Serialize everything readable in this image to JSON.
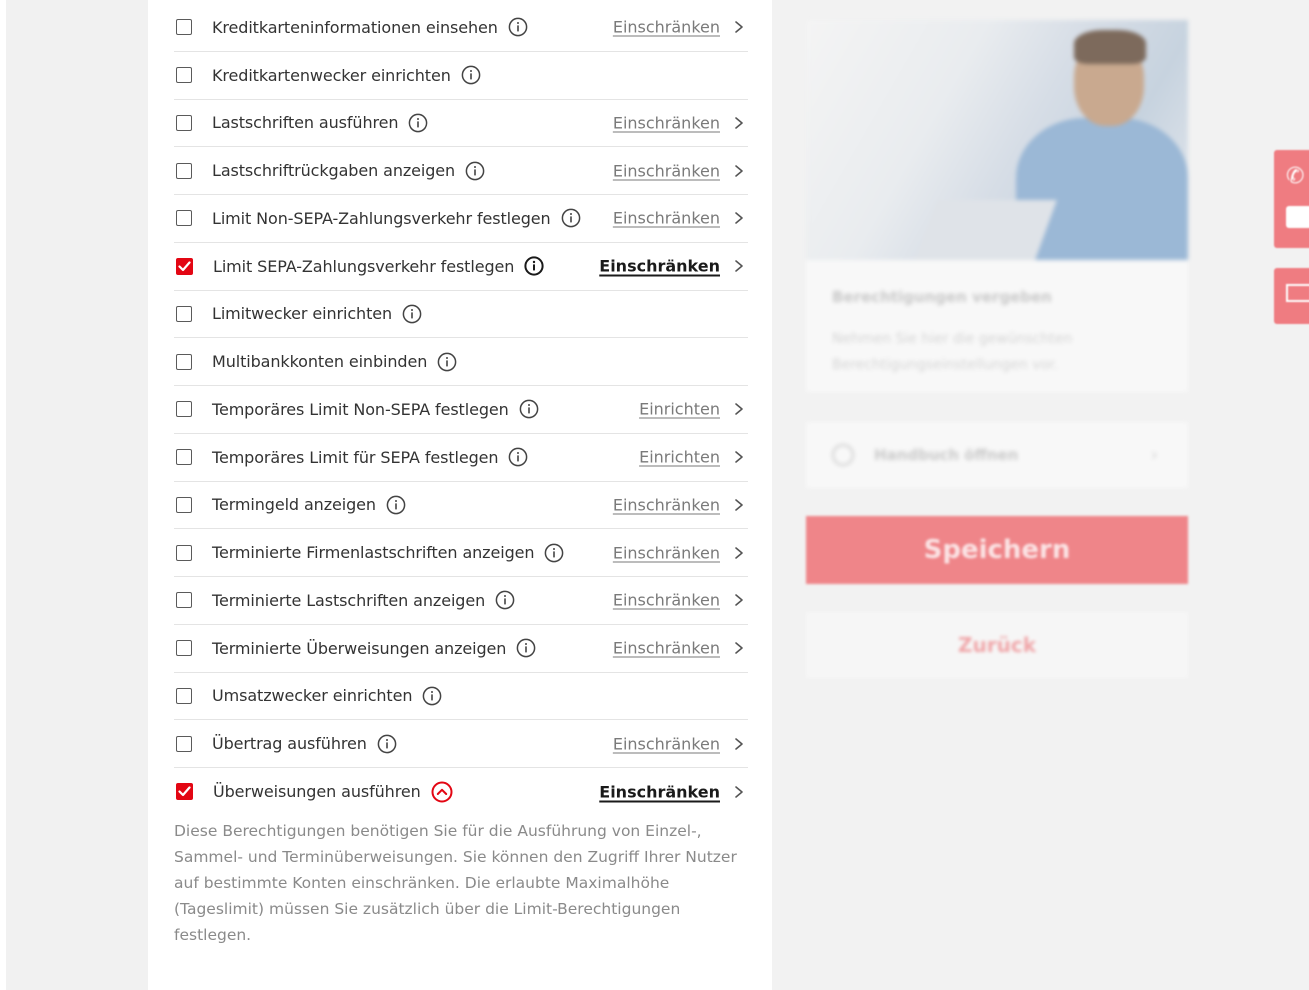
{
  "permissions": [
    {
      "label": "Kreditkarteninformationen einsehen",
      "checked": false,
      "action": "Einschränken",
      "action_active": false,
      "info_icon": "info-icon"
    },
    {
      "label": "Kreditkartenwecker einrichten",
      "checked": false,
      "action": "",
      "action_active": false,
      "info_icon": "info-icon"
    },
    {
      "label": "Lastschriften ausführen",
      "checked": false,
      "action": "Einschränken",
      "action_active": false,
      "info_icon": "info-icon"
    },
    {
      "label": "Lastschriftrückgaben anzeigen",
      "checked": false,
      "action": "Einschränken",
      "action_active": false,
      "info_icon": "info-icon"
    },
    {
      "label": "Limit Non-SEPA-Zahlungsverkehr festlegen",
      "checked": false,
      "action": "Einschränken",
      "action_active": false,
      "info_icon": "info-icon"
    },
    {
      "label": "Limit SEPA-Zahlungsverkehr festlegen",
      "checked": true,
      "action": "Einschränken",
      "action_active": true,
      "info_icon": "info-icon"
    },
    {
      "label": "Limitwecker einrichten",
      "checked": false,
      "action": "",
      "action_active": false,
      "info_icon": "info-icon"
    },
    {
      "label": "Multibankkonten einbinden",
      "checked": false,
      "action": "",
      "action_active": false,
      "info_icon": "info-icon"
    },
    {
      "label": "Temporäres Limit Non-SEPA festlegen",
      "checked": false,
      "action": "Einrichten",
      "action_active": false,
      "info_icon": "info-icon"
    },
    {
      "label": "Temporäres Limit für SEPA festlegen",
      "checked": false,
      "action": "Einrichten",
      "action_active": false,
      "info_icon": "info-icon"
    },
    {
      "label": "Termingeld anzeigen",
      "checked": false,
      "action": "Einschränken",
      "action_active": false,
      "info_icon": "info-icon"
    },
    {
      "label": "Terminierte Firmenlastschriften anzeigen",
      "checked": false,
      "action": "Einschränken",
      "action_active": false,
      "info_icon": "info-icon"
    },
    {
      "label": "Terminierte Lastschriften anzeigen",
      "checked": false,
      "action": "Einschränken",
      "action_active": false,
      "info_icon": "info-icon"
    },
    {
      "label": "Terminierte Überweisungen anzeigen",
      "checked": false,
      "action": "Einschränken",
      "action_active": false,
      "info_icon": "info-icon"
    },
    {
      "label": "Umsatzwecker einrichten",
      "checked": false,
      "action": "",
      "action_active": false,
      "info_icon": "info-icon"
    },
    {
      "label": "Übertrag ausführen",
      "checked": false,
      "action": "Einschränken",
      "action_active": false,
      "info_icon": "info-icon"
    },
    {
      "label": "Überweisungen ausführen",
      "checked": true,
      "action": "Einschränken",
      "action_active": true,
      "info_icon": "collapse-chevron-up-icon",
      "expanded": true
    }
  ],
  "description": "Diese Berechtigungen benötigen Sie für die Ausführung von Einzel-, Sammel- und Terminüberweisungen. Sie können den Zugriff Ihrer Nutzer auf bestimmte Konten einschränken. Die erlaubte Maximalhöhe (Tageslimit) müssen Sie zusätzlich über die Limit-Berechtigungen festlegen.",
  "sidebar": {
    "card_title": "Berechtigungen vergeben",
    "card_text": "Nehmen Sie hier die gewünschten Berechtigungseinstellungen vor.",
    "manual_label": "Handbuch öffnen",
    "save_label": "Speichern",
    "back_label": "Zurück"
  },
  "side_tabs": {
    "phone_icon": "phone-icon",
    "mail_icon": "mail-icon"
  },
  "colors": {
    "accent": "#e30613",
    "save_button": "#ef8589",
    "text": "#333333",
    "muted_link": "#7a7a7a"
  }
}
